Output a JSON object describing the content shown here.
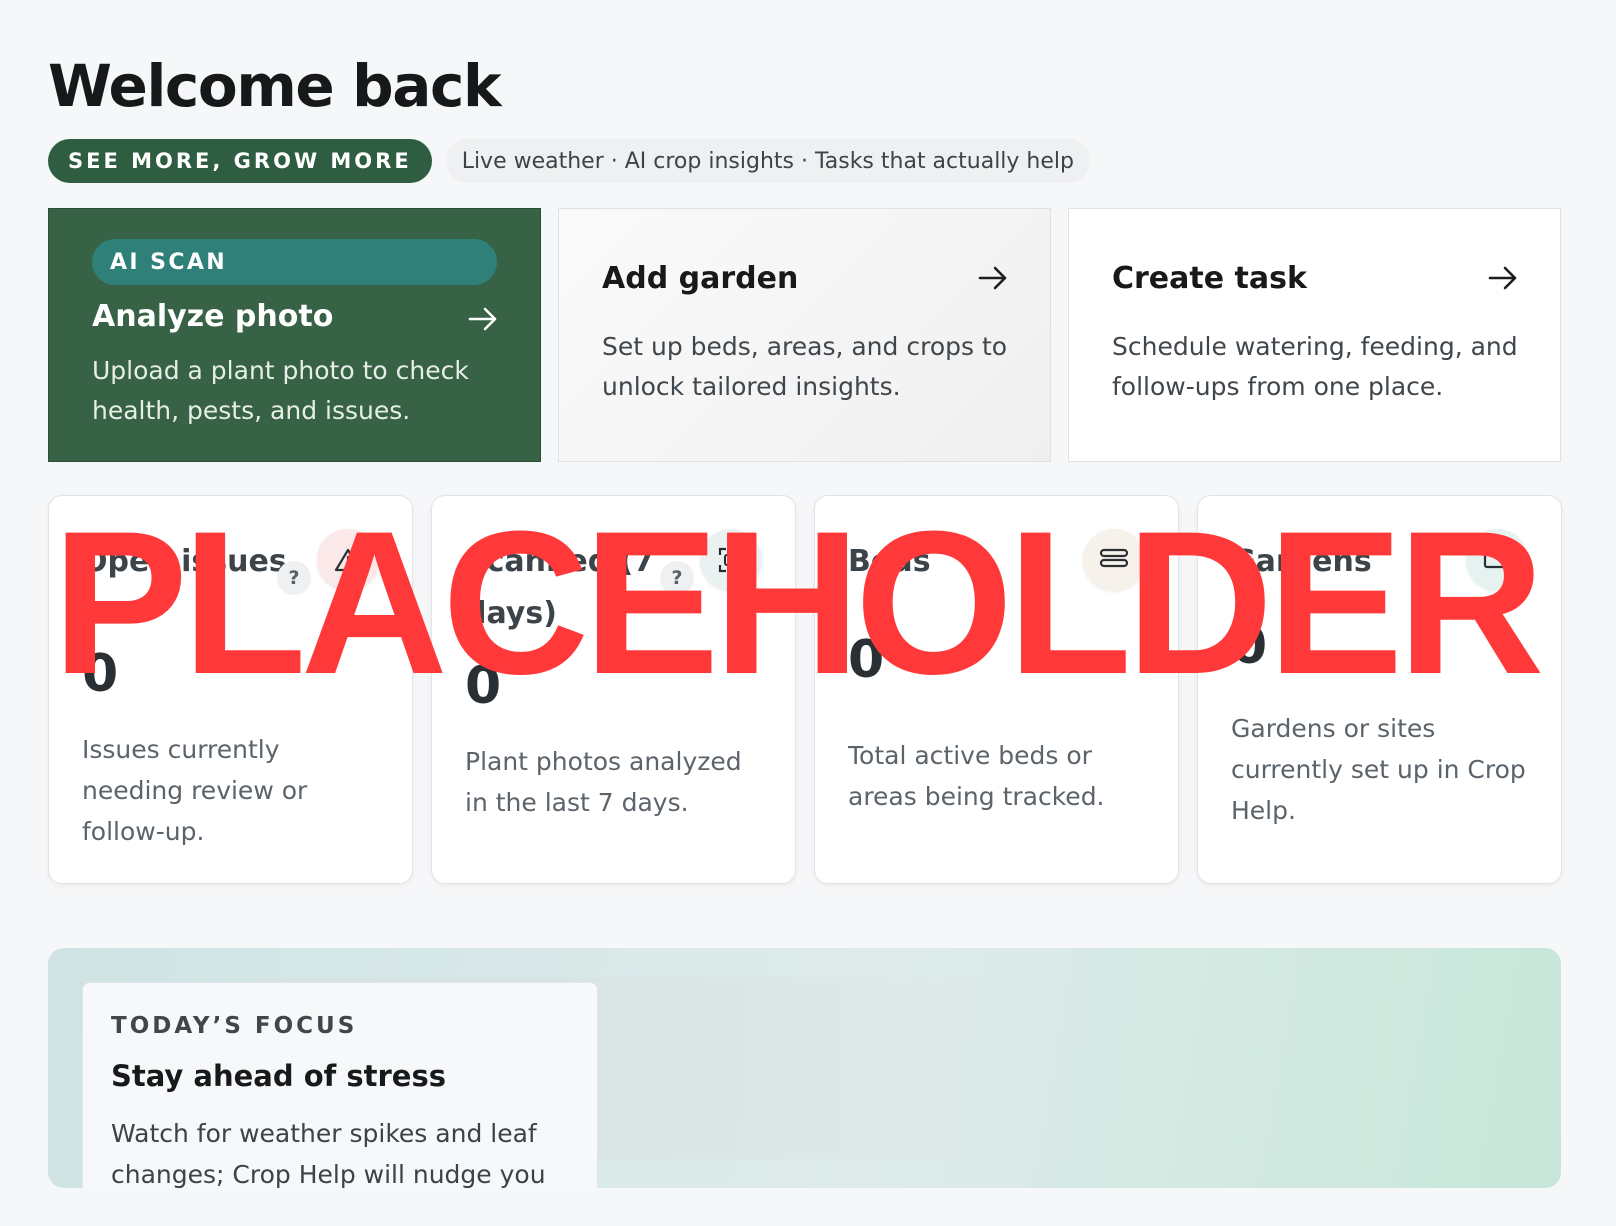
{
  "header": {
    "title": "Welcome back",
    "tagline_badge": "SEE MORE, GROW MORE",
    "features_text": "Live weather · AI crop insights · Tasks that actually help"
  },
  "actions": [
    {
      "pill": "AI SCAN",
      "title": "Analyze photo",
      "description": "Upload a plant photo to check health, pests, and issues.",
      "icon": "arrow-right-icon"
    },
    {
      "title": "Add garden",
      "description": "Set up beds, areas, and crops to unlock tailored insights.",
      "icon": "arrow-right-icon"
    },
    {
      "title": "Create task",
      "description": "Schedule watering, feeding, and follow-ups from one place.",
      "icon": "arrow-right-icon"
    }
  ],
  "stats": [
    {
      "label": "Open issues",
      "value": "0",
      "description": "Issues currently needing review or follow-up.",
      "help": "?",
      "icon": "warning-icon",
      "icon_bg": "#fbe9ea"
    },
    {
      "label": "Scanned (7 days)",
      "value": "0",
      "description": "Plant photos analyzed in the last 7 days.",
      "help": "?",
      "icon": "scan-icon",
      "icon_bg": "#eaf1f1"
    },
    {
      "label": "Beds",
      "value": "0",
      "description": "Total active beds or areas being tracked.",
      "icon": "beds-icon",
      "icon_bg": "#f6f1ea"
    },
    {
      "label": "Gardens",
      "value": "0",
      "description": "Gardens or sites currently set up in Crop Help.",
      "icon": "garden-icon",
      "icon_bg": "#e6f2ef"
    }
  ],
  "focus": {
    "kicker": "TODAY’S FOCUS",
    "title": "Stay ahead of stress",
    "description": "Watch for weather spikes and leaf changes; Crop Help will nudge you"
  },
  "overlay": {
    "text": "PLACEHOLDER"
  },
  "colors": {
    "brand_green": "#2f5d41",
    "scan_card": "#376245",
    "scan_pill": "#2e8079",
    "overlay_red": "#ff3939"
  }
}
